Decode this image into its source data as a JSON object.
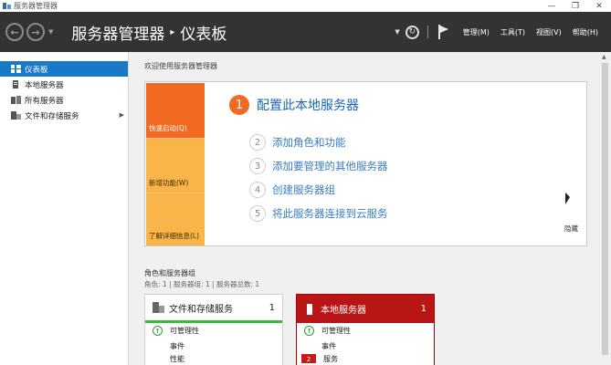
{
  "window": {
    "title": "服务器管理器",
    "controls": [
      "—",
      "❐",
      "✕"
    ]
  },
  "header": {
    "breadcrumb": [
      "服务器管理器",
      "仪表板"
    ],
    "menus": [
      "管理(M)",
      "工具(T)",
      "视图(V)",
      "帮助(H)"
    ]
  },
  "sidebar": {
    "items": [
      {
        "label": "仪表板",
        "icon": "dashboard-icon"
      },
      {
        "label": "本地服务器",
        "icon": "server-icon"
      },
      {
        "label": "所有服务器",
        "icon": "servers-icon"
      },
      {
        "label": "文件和存储服务",
        "icon": "file-storage-icon"
      }
    ]
  },
  "welcome": {
    "title": "欢迎使用服务器管理器",
    "tabs": [
      "快速启动(Q)",
      "新增功能(W)",
      "了解详细信息(L)"
    ],
    "step1": {
      "num": "1",
      "label": "配置此本地服务器"
    },
    "steps": [
      {
        "num": "2",
        "label": "添加角色和功能"
      },
      {
        "num": "3",
        "label": "添加要管理的其他服务器"
      },
      {
        "num": "4",
        "label": "创建服务器组"
      },
      {
        "num": "5",
        "label": "将此服务器连接到云服务"
      }
    ],
    "hide": "隐藏"
  },
  "roles": {
    "title": "角色和服务器组",
    "subtitle": "角色: 1 | 服务器组: 1 | 服务器总数: 1",
    "tiles": [
      {
        "name": "文件和存储服务",
        "count": "1",
        "rows": [
          "可管理性",
          "事件",
          "性能"
        ]
      },
      {
        "name": "本地服务器",
        "count": "1",
        "rows": [
          "可管理性",
          "事件",
          "服务"
        ],
        "badge": "2"
      }
    ]
  },
  "colors": {
    "header_bg": "#333333",
    "accent_blue": "#1a78c8",
    "quickstart_orange": "#f26a21",
    "tab_yellow": "#f9b44a",
    "alert_red": "#b81616",
    "ok_green": "#2fbf2f"
  }
}
